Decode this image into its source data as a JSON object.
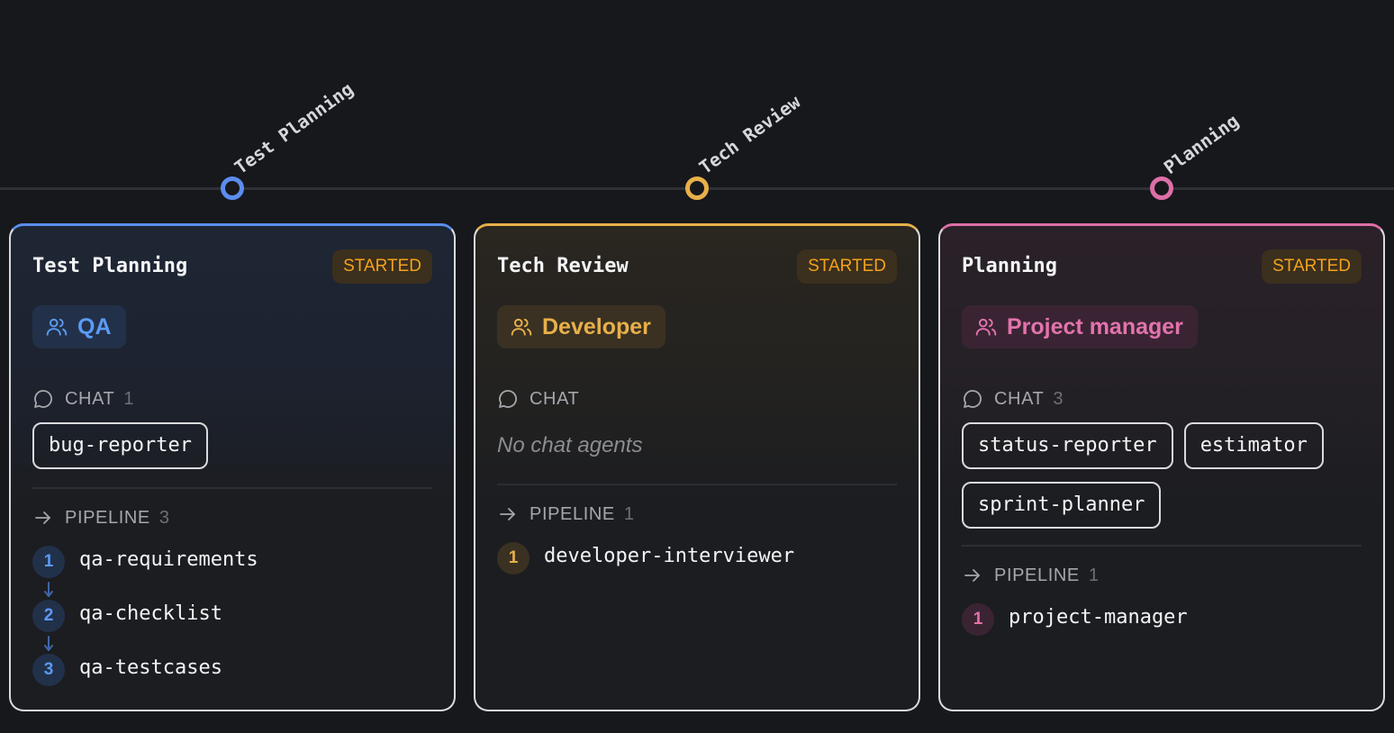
{
  "timeline": {
    "stages": [
      {
        "label": "Test Planning",
        "color": "#5b8def"
      },
      {
        "label": "Tech Review",
        "color": "#e8b04a"
      },
      {
        "label": "Planning",
        "color": "#dd6fa7"
      }
    ]
  },
  "cards": [
    {
      "title": "Test Planning",
      "status": "STARTED",
      "role": "QA",
      "role_icon": "users-icon",
      "accent": "#5b8def",
      "chat": {
        "label": "CHAT",
        "count": "1",
        "agents": [
          "bug-reporter"
        ],
        "empty_text": ""
      },
      "pipeline": {
        "label": "PIPELINE",
        "count": "3",
        "steps": [
          {
            "num": "1",
            "name": "qa-requirements"
          },
          {
            "num": "2",
            "name": "qa-checklist"
          },
          {
            "num": "3",
            "name": "qa-testcases"
          }
        ]
      }
    },
    {
      "title": "Tech Review",
      "status": "STARTED",
      "role": "Developer",
      "role_icon": "users-icon",
      "accent": "#e8b04a",
      "chat": {
        "label": "CHAT",
        "count": "",
        "agents": [],
        "empty_text": "No chat agents"
      },
      "pipeline": {
        "label": "PIPELINE",
        "count": "1",
        "steps": [
          {
            "num": "1",
            "name": "developer-interviewer"
          }
        ]
      }
    },
    {
      "title": "Planning",
      "status": "STARTED",
      "role": "Project manager",
      "role_icon": "users-icon",
      "accent": "#dd6fa7",
      "chat": {
        "label": "CHAT",
        "count": "3",
        "agents": [
          "status-reporter",
          "estimator",
          "sprint-planner"
        ],
        "empty_text": ""
      },
      "pipeline": {
        "label": "PIPELINE",
        "count": "1",
        "steps": [
          {
            "num": "1",
            "name": "project-manager"
          }
        ]
      }
    }
  ],
  "theme": {
    "background": "#17181b",
    "status_badge_bg": "#3b2f1d",
    "status_badge_text": "#f4a21c"
  }
}
